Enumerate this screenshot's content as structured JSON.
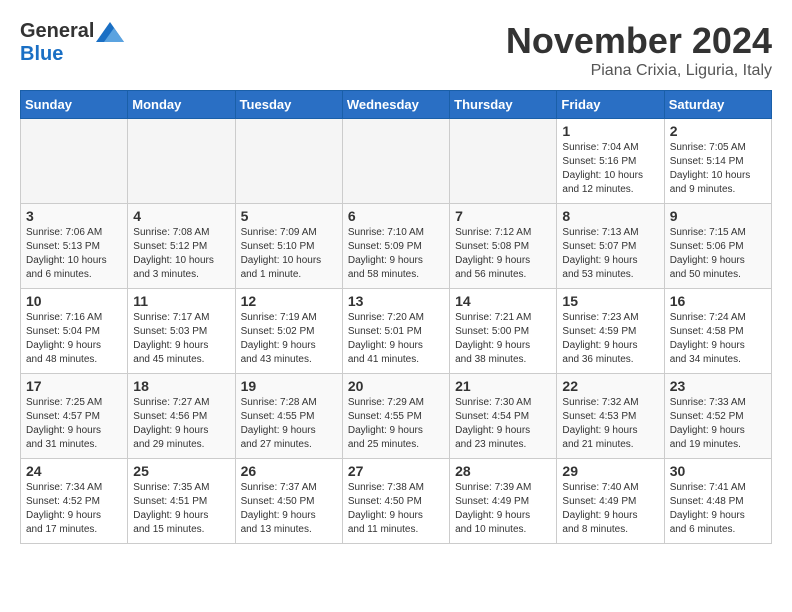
{
  "logo": {
    "general": "General",
    "blue": "Blue"
  },
  "title": "November 2024",
  "subtitle": "Piana Crixia, Liguria, Italy",
  "days_header": [
    "Sunday",
    "Monday",
    "Tuesday",
    "Wednesday",
    "Thursday",
    "Friday",
    "Saturday"
  ],
  "weeks": [
    [
      {
        "day": "",
        "info": ""
      },
      {
        "day": "",
        "info": ""
      },
      {
        "day": "",
        "info": ""
      },
      {
        "day": "",
        "info": ""
      },
      {
        "day": "",
        "info": ""
      },
      {
        "day": "1",
        "info": "Sunrise: 7:04 AM\nSunset: 5:16 PM\nDaylight: 10 hours\nand 12 minutes."
      },
      {
        "day": "2",
        "info": "Sunrise: 7:05 AM\nSunset: 5:14 PM\nDaylight: 10 hours\nand 9 minutes."
      }
    ],
    [
      {
        "day": "3",
        "info": "Sunrise: 7:06 AM\nSunset: 5:13 PM\nDaylight: 10 hours\nand 6 minutes."
      },
      {
        "day": "4",
        "info": "Sunrise: 7:08 AM\nSunset: 5:12 PM\nDaylight: 10 hours\nand 3 minutes."
      },
      {
        "day": "5",
        "info": "Sunrise: 7:09 AM\nSunset: 5:10 PM\nDaylight: 10 hours\nand 1 minute."
      },
      {
        "day": "6",
        "info": "Sunrise: 7:10 AM\nSunset: 5:09 PM\nDaylight: 9 hours\nand 58 minutes."
      },
      {
        "day": "7",
        "info": "Sunrise: 7:12 AM\nSunset: 5:08 PM\nDaylight: 9 hours\nand 56 minutes."
      },
      {
        "day": "8",
        "info": "Sunrise: 7:13 AM\nSunset: 5:07 PM\nDaylight: 9 hours\nand 53 minutes."
      },
      {
        "day": "9",
        "info": "Sunrise: 7:15 AM\nSunset: 5:06 PM\nDaylight: 9 hours\nand 50 minutes."
      }
    ],
    [
      {
        "day": "10",
        "info": "Sunrise: 7:16 AM\nSunset: 5:04 PM\nDaylight: 9 hours\nand 48 minutes."
      },
      {
        "day": "11",
        "info": "Sunrise: 7:17 AM\nSunset: 5:03 PM\nDaylight: 9 hours\nand 45 minutes."
      },
      {
        "day": "12",
        "info": "Sunrise: 7:19 AM\nSunset: 5:02 PM\nDaylight: 9 hours\nand 43 minutes."
      },
      {
        "day": "13",
        "info": "Sunrise: 7:20 AM\nSunset: 5:01 PM\nDaylight: 9 hours\nand 41 minutes."
      },
      {
        "day": "14",
        "info": "Sunrise: 7:21 AM\nSunset: 5:00 PM\nDaylight: 9 hours\nand 38 minutes."
      },
      {
        "day": "15",
        "info": "Sunrise: 7:23 AM\nSunset: 4:59 PM\nDaylight: 9 hours\nand 36 minutes."
      },
      {
        "day": "16",
        "info": "Sunrise: 7:24 AM\nSunset: 4:58 PM\nDaylight: 9 hours\nand 34 minutes."
      }
    ],
    [
      {
        "day": "17",
        "info": "Sunrise: 7:25 AM\nSunset: 4:57 PM\nDaylight: 9 hours\nand 31 minutes."
      },
      {
        "day": "18",
        "info": "Sunrise: 7:27 AM\nSunset: 4:56 PM\nDaylight: 9 hours\nand 29 minutes."
      },
      {
        "day": "19",
        "info": "Sunrise: 7:28 AM\nSunset: 4:55 PM\nDaylight: 9 hours\nand 27 minutes."
      },
      {
        "day": "20",
        "info": "Sunrise: 7:29 AM\nSunset: 4:55 PM\nDaylight: 9 hours\nand 25 minutes."
      },
      {
        "day": "21",
        "info": "Sunrise: 7:30 AM\nSunset: 4:54 PM\nDaylight: 9 hours\nand 23 minutes."
      },
      {
        "day": "22",
        "info": "Sunrise: 7:32 AM\nSunset: 4:53 PM\nDaylight: 9 hours\nand 21 minutes."
      },
      {
        "day": "23",
        "info": "Sunrise: 7:33 AM\nSunset: 4:52 PM\nDaylight: 9 hours\nand 19 minutes."
      }
    ],
    [
      {
        "day": "24",
        "info": "Sunrise: 7:34 AM\nSunset: 4:52 PM\nDaylight: 9 hours\nand 17 minutes."
      },
      {
        "day": "25",
        "info": "Sunrise: 7:35 AM\nSunset: 4:51 PM\nDaylight: 9 hours\nand 15 minutes."
      },
      {
        "day": "26",
        "info": "Sunrise: 7:37 AM\nSunset: 4:50 PM\nDaylight: 9 hours\nand 13 minutes."
      },
      {
        "day": "27",
        "info": "Sunrise: 7:38 AM\nSunset: 4:50 PM\nDaylight: 9 hours\nand 11 minutes."
      },
      {
        "day": "28",
        "info": "Sunrise: 7:39 AM\nSunset: 4:49 PM\nDaylight: 9 hours\nand 10 minutes."
      },
      {
        "day": "29",
        "info": "Sunrise: 7:40 AM\nSunset: 4:49 PM\nDaylight: 9 hours\nand 8 minutes."
      },
      {
        "day": "30",
        "info": "Sunrise: 7:41 AM\nSunset: 4:48 PM\nDaylight: 9 hours\nand 6 minutes."
      }
    ]
  ]
}
